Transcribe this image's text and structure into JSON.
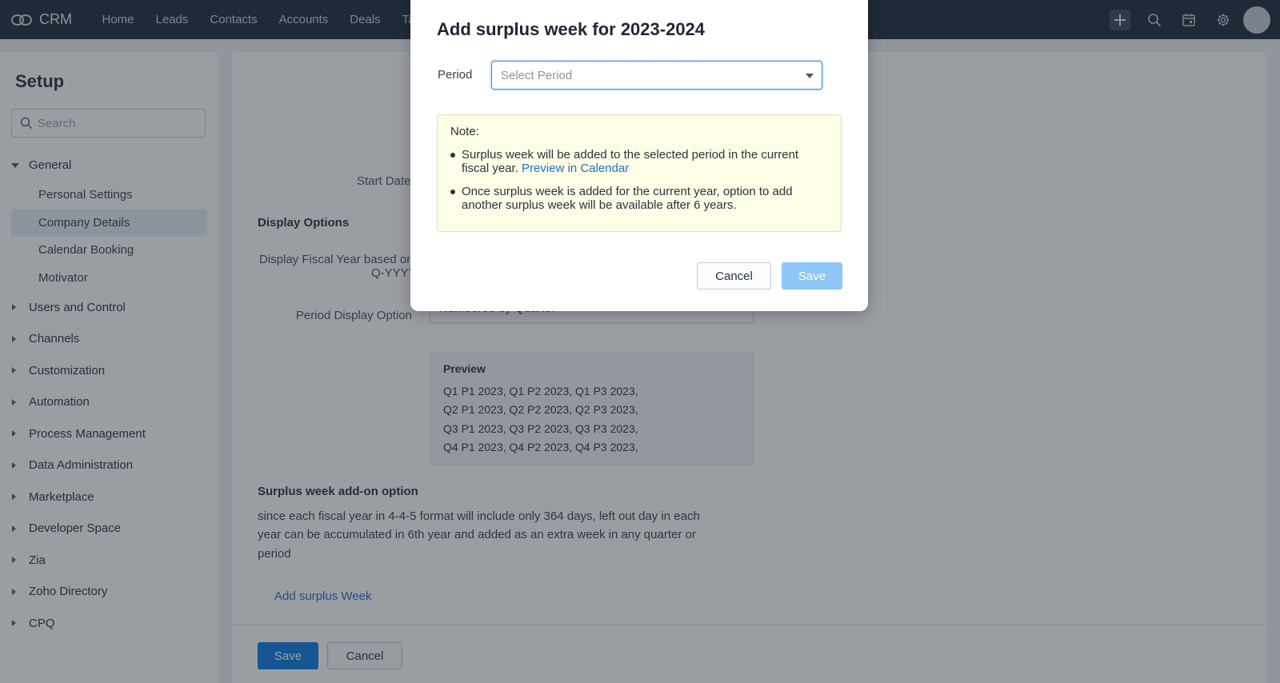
{
  "topbar": {
    "app_name": "CRM",
    "nav": [
      "Home",
      "Leads",
      "Contacts",
      "Accounts",
      "Deals",
      "Ta"
    ]
  },
  "sidebar": {
    "title": "Setup",
    "search_placeholder": "Search",
    "groups": [
      {
        "label": "General",
        "open": true,
        "items": [
          "Personal Settings",
          "Company Details",
          "Calendar Booking",
          "Motivator"
        ],
        "active_item": "Company Details"
      },
      {
        "label": "Users and Control"
      },
      {
        "label": "Channels"
      },
      {
        "label": "Customization"
      },
      {
        "label": "Automation"
      },
      {
        "label": "Process Management"
      },
      {
        "label": "Data Administration"
      },
      {
        "label": "Marketplace"
      },
      {
        "label": "Developer Space"
      },
      {
        "label": "Zia"
      },
      {
        "label": "Zoho Directory"
      },
      {
        "label": "CPQ"
      }
    ]
  },
  "main": {
    "start_date_label": "Start Date",
    "display_options_heading": "Display Options",
    "display_fiscal_label_1": "Display Fiscal Year based on",
    "display_fiscal_label_2": "Q-YYYY",
    "period_display_label": "Period Display Option",
    "period_display_value": "Numbered by Quarter",
    "preview_heading": "Preview",
    "preview_lines": [
      "Q1 P1 2023, Q1 P2 2023, Q1 P3 2023,",
      "Q2 P1 2023, Q2 P2 2023, Q2 P3 2023,",
      "Q3 P1 2023, Q3 P2 2023, Q3 P3 2023,",
      "Q4 P1 2023, Q4 P2 2023, Q4 P3 2023,"
    ],
    "surplus_heading": "Surplus week add-on option",
    "surplus_text_lines": [
      "since each fiscal year in 4-4-5 format will include only 364 days, left out day in each",
      "year can be accumulated in 6th year and added as an extra week in any quarter or",
      "period"
    ],
    "add_surplus_link": "Add surplus Week",
    "save_label": "Save",
    "cancel_label": "Cancel"
  },
  "modal": {
    "title": "Add surplus week for 2023-2024",
    "period_label": "Period",
    "period_placeholder": "Select Period",
    "note_heading": "Note:",
    "note_1_text": "Surplus week will be added to the selected period in the current fiscal year.",
    "note_1_link": "Preview in Calendar",
    "note_2_text": "Once surplus week is added for the current year, option to add another surplus week will be available after 6 years.",
    "cancel_label": "Cancel",
    "save_label": "Save"
  },
  "colors": {
    "topbar_bg": "#1f2c3d",
    "primary": "#0e7de1",
    "link": "#1a73c8",
    "note_bg": "#fefde6",
    "disabled_save": "#8ec6f8"
  }
}
